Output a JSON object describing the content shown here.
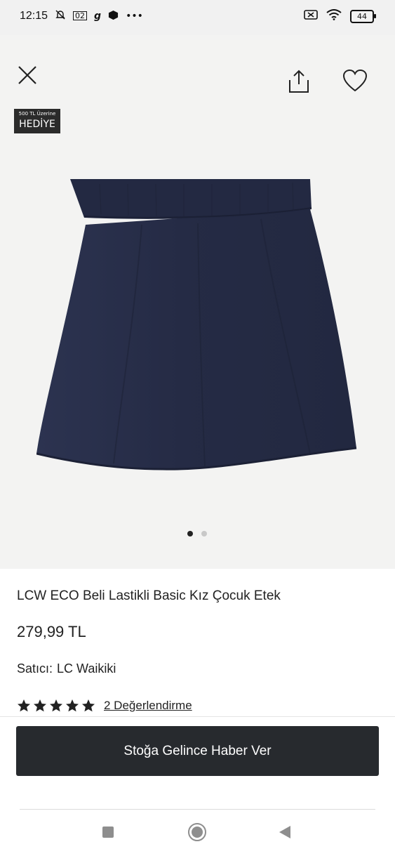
{
  "status_bar": {
    "time": "12:15",
    "icons_left": [
      "mute-bell-icon",
      "carrier-02-icon",
      "g-app-icon",
      "box-icon",
      "more-dots-icon"
    ],
    "icons_right": [
      "no-sim-icon",
      "wifi-icon",
      "battery-icon"
    ],
    "carrier_badge": "02",
    "app_letter": "g",
    "more": "•••",
    "battery_level": "44"
  },
  "header": {
    "icons": [
      "close-icon",
      "share-icon",
      "heart-icon"
    ]
  },
  "promo_badge": {
    "top": "500 TL Üzerine",
    "main": "HEDİYE"
  },
  "gallery": {
    "dots": 2,
    "active": 0
  },
  "product": {
    "title": "LCW ECO Beli Lastikli Basic Kız Çocuk Etek",
    "price": "279,99 TL",
    "seller_label": "Satıcı:",
    "seller_name": "LC Waikiki",
    "rating_stars": 5,
    "reviews_label": "2 Değerlendirme"
  },
  "cta": {
    "label": "Stoğa Gelince Haber Ver"
  },
  "colors": {
    "cta_bg": "#272a2e",
    "skirt": "#272d45",
    "image_bg": "#f3f3f2"
  },
  "nav_bar": {
    "icons": [
      "recent-apps-icon",
      "home-icon",
      "back-icon"
    ]
  }
}
